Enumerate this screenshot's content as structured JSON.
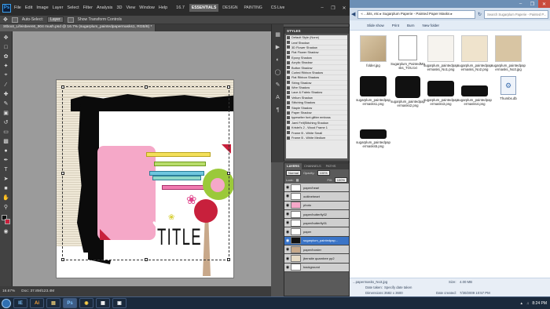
{
  "photoshop": {
    "logo": "Ps",
    "menu": [
      "File",
      "Edit",
      "Image",
      "Layer",
      "Select",
      "Filter",
      "Analysis",
      "3D",
      "View",
      "Window",
      "Help"
    ],
    "zoom": "16.7",
    "workspaces": [
      "ESSENTIALS",
      "DESIGN",
      "PAINTING"
    ],
    "cslive": "CS Live",
    "options": {
      "auto_select": "Auto-Select:",
      "auto_select_value": "Layer",
      "transform_controls": "Show Transform Controls"
    },
    "tabs": [
      "Stboot_Lifeisbeen6_904 mush.psd @ 16.7% (sugarplum_paintedpapermasks1, RGB/8) *"
    ],
    "document_title": "TITLE",
    "status": {
      "zoom": "16.67%",
      "doc": "Doc: 37.8M/123.4M"
    },
    "styles_panel": {
      "title": "STYLES",
      "items": [
        "Default Style (None)",
        "Leaf Shadow",
        "3D Flower Shadow",
        "Flat Flower Shadow",
        "Epoxy Shadow",
        "Acrylic Shadow",
        "Button Shadow",
        "Curled Ribbon Shadow",
        "Flat Ribbon Shadow",
        "String Shadow",
        "Wire Shadow",
        "Lace & Fabric Shadow",
        "Vellum Shadow",
        "Stitching Shadow",
        "Staple Shadow",
        "Paper Shadow",
        "typewriter font glitter emboss",
        "Jami Felt|Stitching Shadow",
        "Kristel's 2 - Wood Frame 1",
        "Frame B - White Small",
        "Frame B - White Medium"
      ]
    },
    "layers_panel": {
      "tabs": [
        "LAYERS",
        "CHANNELS",
        "PATHS"
      ],
      "blend": "Normal",
      "opacity_label": "Opacity:",
      "opacity": "100%",
      "lock_label": "Lock:",
      "fill_label": "Fill:",
      "fill": "100%",
      "layers": [
        {
          "name": "paper/heart",
          "active": false
        },
        {
          "name": "outlineheart",
          "active": false
        },
        {
          "name": "photo",
          "active": false
        },
        {
          "name": "paper/butterfly02",
          "active": false
        },
        {
          "name": "paper/butterfly01",
          "active": false
        },
        {
          "name": "paper",
          "active": false
        },
        {
          "name": "sugarplum_paintedpap...",
          "active": true
        },
        {
          "name": "paper/border",
          "active": false
        },
        {
          "name": "jbensite quarnbee pp2",
          "active": false
        },
        {
          "name": "background",
          "active": false
        }
      ]
    }
  },
  "explorer": {
    "address": "« ...kits, etc ▸ Sugarplum Paperie - Painted Paper Masks ▸",
    "search_placeholder": "Search Sugarplum Paperie - Painted P...",
    "toolbar": [
      "Slide show",
      "Print",
      "Burn",
      "New folder"
    ],
    "files": [
      {
        "name": "folder.jpg",
        "thumb": "kraft"
      },
      {
        "name": "Sugarplum_PaintedMasks_TOU.txt",
        "thumb": "text"
      },
      {
        "name": "sugarplum_paintedpapermasks_No1.png",
        "thumb": "paper-white"
      },
      {
        "name": "sugarplum_paintedpapermasks_No2.png",
        "thumb": "paper-cream"
      },
      {
        "name": "sugarplum_paintedpapermasks_No3.jpg",
        "thumb": "paper-tan"
      },
      {
        "name": "sugarplum_paintedpapermasks1.png",
        "thumb": "mask-black"
      },
      {
        "name": "sugarplum_paintedpapermasks2.png",
        "thumb": "mask-black"
      },
      {
        "name": "sugarplum_paintedpapermasks3.png",
        "thumb": "mask-black"
      },
      {
        "name": "sugarplum_paintedpapermasks4.png",
        "thumb": "mask-black"
      },
      {
        "name": "sugarplum_paintedpapermasks5.png",
        "thumb": "mask-black"
      },
      {
        "name": "Thumbs.db",
        "thumb": "db"
      }
    ],
    "details": {
      "filename": "...papermasks_No3.jpg",
      "date_label": "Date taken:",
      "date_value": "Specify date taken",
      "size_label": "Size:",
      "size_value": "4.00 MB",
      "dims_label": "Dimensions:",
      "dims_value": "3582 x 3600",
      "modified_label": "Date created:",
      "modified_value": "7/30/2009 10:57 PM"
    }
  },
  "taskbar": {
    "apps": [
      "IE",
      "Ai",
      "▤",
      "Ps",
      "◉",
      "▦",
      "▣"
    ],
    "active_app": "Ps",
    "time": "8:24 PM"
  },
  "colors": {
    "ps_bg": "#535353",
    "accent_blue": "#3a74c7",
    "pink": "#f5a8c8",
    "lime": "#9bc93a",
    "red": "#c8203c"
  }
}
